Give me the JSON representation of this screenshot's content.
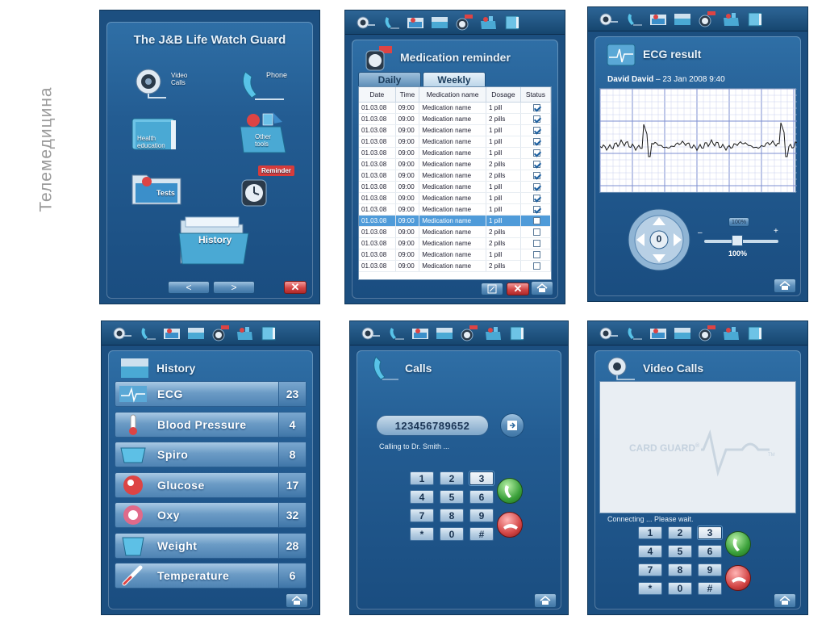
{
  "caption": "Телемедицина",
  "colors": {
    "panel_bg": "#1c4f80",
    "window_grad_top": "#2f6fa6",
    "accent_red": "#d34646",
    "accent_green": "#3aa03a"
  },
  "toolbar_icons": [
    "video-camera-icon",
    "phone-icon",
    "tests-folder-icon",
    "history-folder-icon",
    "reminder-clock-icon",
    "other-tools-box-icon",
    "health-education-book-icon"
  ],
  "main_menu": {
    "title": "The J&B Life Watch Guard",
    "items": {
      "video_calls": "Video\nCalls",
      "phone": "Phone",
      "health_education": "Health\neducation",
      "other_tools": "Other\ntools",
      "tests": "Tests",
      "reminder": "Reminder",
      "history": "History"
    },
    "prev_symbol": "<",
    "next_symbol": ">",
    "close_symbol": "✕"
  },
  "medication": {
    "title": "Medication reminder",
    "tabs": [
      {
        "label": "Daily",
        "active": false
      },
      {
        "label": "Weekly",
        "active": true
      }
    ],
    "columns": [
      "Date",
      "Time",
      "Medication name",
      "Dosage",
      "Status"
    ],
    "rows": [
      {
        "date": "01.03.08",
        "time": "09:00",
        "name": "Medication name",
        "dosage": "1 pill",
        "checked": true
      },
      {
        "date": "01.03.08",
        "time": "09:00",
        "name": "Medication name",
        "dosage": "2 pills",
        "checked": true
      },
      {
        "date": "01.03.08",
        "time": "09:00",
        "name": "Medication name",
        "dosage": "1 pill",
        "checked": true
      },
      {
        "date": "01.03.08",
        "time": "09:00",
        "name": "Medication name",
        "dosage": "1 pill",
        "checked": true
      },
      {
        "date": "01.03.08",
        "time": "09:00",
        "name": "Medication name",
        "dosage": "1 pill",
        "checked": true
      },
      {
        "date": "01.03.08",
        "time": "09:00",
        "name": "Medication name",
        "dosage": "2 pills",
        "checked": true
      },
      {
        "date": "01.03.08",
        "time": "09:00",
        "name": "Medication name",
        "dosage": "2 pills",
        "checked": true
      },
      {
        "date": "01.03.08",
        "time": "09:00",
        "name": "Medication name",
        "dosage": "1 pill",
        "checked": true
      },
      {
        "date": "01.03.08",
        "time": "09:00",
        "name": "Medication name",
        "dosage": "1 pill",
        "checked": true
      },
      {
        "date": "01.03.08",
        "time": "09:00",
        "name": "Medication name",
        "dosage": "1 pill",
        "checked": true
      },
      {
        "date": "01.03.08",
        "time": "09:00",
        "name": "Medication name",
        "dosage": "1 pill",
        "checked": false,
        "selected": true
      },
      {
        "date": "01.03.08",
        "time": "09:00",
        "name": "Medication name",
        "dosage": "2 pills",
        "checked": false
      },
      {
        "date": "01.03.08",
        "time": "09:00",
        "name": "Medication name",
        "dosage": "2 pills",
        "checked": false
      },
      {
        "date": "01.03.08",
        "time": "09:00",
        "name": "Medication name",
        "dosage": "1 pill",
        "checked": false
      },
      {
        "date": "01.03.08",
        "time": "09:00",
        "name": "Medication name",
        "dosage": "2 pills",
        "checked": false
      }
    ]
  },
  "ecg": {
    "title": "ECG result",
    "patient": "David David",
    "date_sep": "–",
    "date": "23 Jan 2008",
    "time": "9:40",
    "zoom_top": "100%",
    "zoom_bottom": "100%",
    "minus": "–",
    "plus": "+",
    "center": "0"
  },
  "history": {
    "title": "History",
    "items": [
      {
        "label": "ECG",
        "count": "23",
        "icon": "ecg-icon"
      },
      {
        "label": "Blood Pressure",
        "count": "4",
        "icon": "thermometer-icon"
      },
      {
        "label": "Spiro",
        "count": "8",
        "icon": "spiro-icon"
      },
      {
        "label": "Glucose",
        "count": "17",
        "icon": "glucose-icon"
      },
      {
        "label": "Oxy",
        "count": "32",
        "icon": "oxy-icon"
      },
      {
        "label": "Weight",
        "count": "28",
        "icon": "weight-icon"
      },
      {
        "label": "Temperature",
        "count": "6",
        "icon": "temperature-icon"
      }
    ]
  },
  "calls": {
    "title": "Calls",
    "number": "123456789652",
    "status": "Calling to Dr. Smith ...",
    "keys": [
      "1",
      "2",
      "3",
      "4",
      "5",
      "6",
      "7",
      "8",
      "9",
      "*",
      "0",
      "#"
    ],
    "pressed_key": "3"
  },
  "video": {
    "title": "Video Calls",
    "logo_text": "CARD GUARD",
    "logo_reg": "®",
    "logo_tm": "TM",
    "status": "Connecting ... Please wait.",
    "keys": [
      "1",
      "2",
      "3",
      "4",
      "5",
      "6",
      "7",
      "8",
      "9",
      "*",
      "0",
      "#"
    ],
    "pressed_key": "3"
  }
}
